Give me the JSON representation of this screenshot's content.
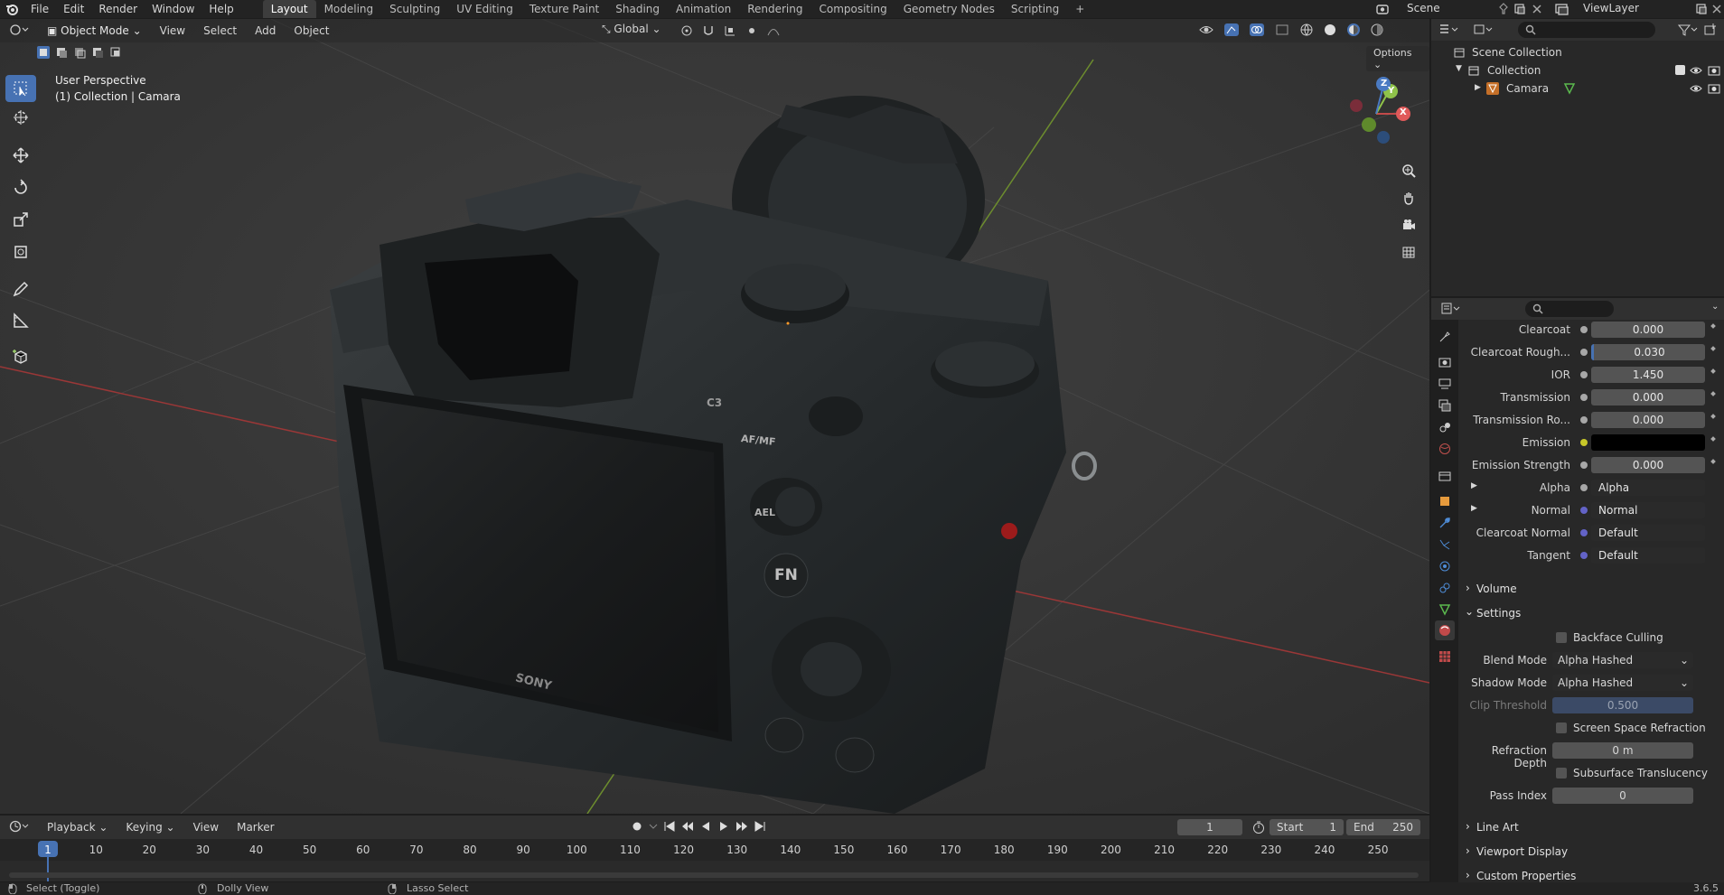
{
  "topbar": {
    "menus": [
      "File",
      "Edit",
      "Render",
      "Window",
      "Help"
    ],
    "workspaces": [
      "Layout",
      "Modeling",
      "Sculpting",
      "UV Editing",
      "Texture Paint",
      "Shading",
      "Animation",
      "Rendering",
      "Compositing",
      "Geometry Nodes",
      "Scripting"
    ],
    "active_workspace": "Layout",
    "add_tab": "+",
    "scene": "Scene",
    "view_layer": "ViewLayer"
  },
  "viewport": {
    "mode": "Object Mode",
    "menus": [
      "View",
      "Select",
      "Add",
      "Object"
    ],
    "transform_orientation": "Global",
    "options_label": "Options",
    "overlay_line1": "User Perspective",
    "overlay_line2": "(1) Collection | Camara",
    "gizmo_axes": [
      "X",
      "Y",
      "Z"
    ],
    "camera_text": {
      "brand": "SONY",
      "afmf": "AF/MF",
      "ael": "AEL",
      "fn": "FN",
      "c3": "C3"
    }
  },
  "outliner": {
    "root": "Scene Collection",
    "collection": "Collection",
    "object": "Camara"
  },
  "properties": {
    "rows": [
      {
        "label": "Clearcoat",
        "value": "0.000"
      },
      {
        "label": "Clearcoat Rough...",
        "value": "0.030"
      },
      {
        "label": "IOR",
        "value": "1.450"
      },
      {
        "label": "Transmission",
        "value": "0.000"
      },
      {
        "label": "Transmission Ro...",
        "value": "0.000"
      },
      {
        "label": "Emission",
        "value": ""
      },
      {
        "label": "Emission Strength",
        "value": "0.000"
      },
      {
        "label": "Alpha",
        "value": "Alpha"
      },
      {
        "label": "Normal",
        "value": "Normal"
      },
      {
        "label": "Clearcoat Normal",
        "value": "Default"
      },
      {
        "label": "Tangent",
        "value": "Default"
      }
    ],
    "sections": {
      "volume": "Volume",
      "settings": "Settings",
      "line_art": "Line Art",
      "viewport_display": "Viewport Display",
      "custom_properties": "Custom Properties"
    },
    "settings": {
      "backface_culling": "Backface Culling",
      "blend_mode_label": "Blend Mode",
      "blend_mode": "Alpha Hashed",
      "shadow_mode_label": "Shadow Mode",
      "shadow_mode": "Alpha Hashed",
      "clip_threshold_label": "Clip Threshold",
      "clip_threshold": "0.500",
      "screen_space_refraction": "Screen Space Refraction",
      "refraction_depth_label": "Refraction Depth",
      "refraction_depth": "0 m",
      "subsurface_translucency": "Subsurface Translucency",
      "pass_index_label": "Pass Index",
      "pass_index": "0"
    }
  },
  "timeline": {
    "menus": [
      "Playback",
      "Keying",
      "View",
      "Marker"
    ],
    "current_frame": "1",
    "start_label": "Start",
    "start": "1",
    "end_label": "End",
    "end": "250",
    "ticks": [
      "1",
      "10",
      "20",
      "30",
      "40",
      "50",
      "60",
      "70",
      "80",
      "90",
      "100",
      "110",
      "120",
      "130",
      "140",
      "150",
      "160",
      "170",
      "180",
      "190",
      "200",
      "210",
      "220",
      "230",
      "240",
      "250"
    ]
  },
  "statusbar": {
    "select": "Select (Toggle)",
    "dolly": "Dolly View",
    "lasso": "Lasso Select",
    "version": "3.6.5"
  }
}
